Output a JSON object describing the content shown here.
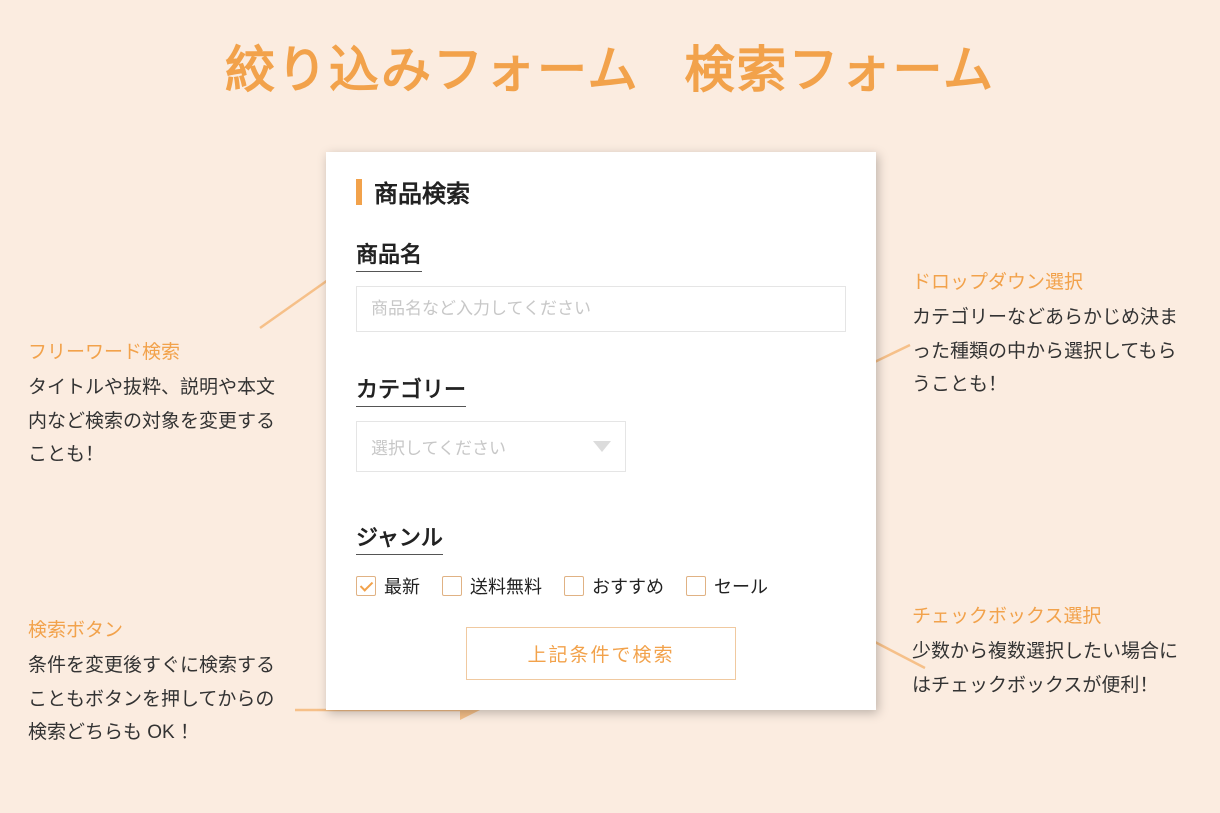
{
  "title": {
    "left": "絞り込みフォーム",
    "right": "検索フォーム"
  },
  "form": {
    "heading": "商品検索",
    "product_name": {
      "label": "商品名",
      "placeholder": "商品名など入力してください"
    },
    "category": {
      "label": "カテゴリー",
      "placeholder": "選択してください"
    },
    "genre": {
      "label": "ジャンル",
      "options": [
        {
          "label": "最新",
          "checked": true
        },
        {
          "label": "送料無料",
          "checked": false
        },
        {
          "label": "おすすめ",
          "checked": false
        },
        {
          "label": "セール",
          "checked": false
        }
      ]
    },
    "submit_label": "上記条件で検索"
  },
  "callouts": {
    "freeword": {
      "title": "フリーワード検索",
      "body": "タイトルや抜粋、説明や本文内など検索の対象を変更することも！"
    },
    "button": {
      "title": "検索ボタン",
      "body": "条件を変更後すぐに検索することもボタンを押してからの検索どちらも OK ！"
    },
    "dropdown": {
      "title": "ドロップダウン選択",
      "body": "カテゴリーなどあらかじめ決まった種類の中から選択してもらうことも！"
    },
    "checkbox": {
      "title": "チェックボックス選択",
      "body": "少数から複数選択したい場合にはチェックボックスが便利！"
    }
  },
  "colors": {
    "accent": "#f2a24b",
    "bg": "#fbece0"
  }
}
